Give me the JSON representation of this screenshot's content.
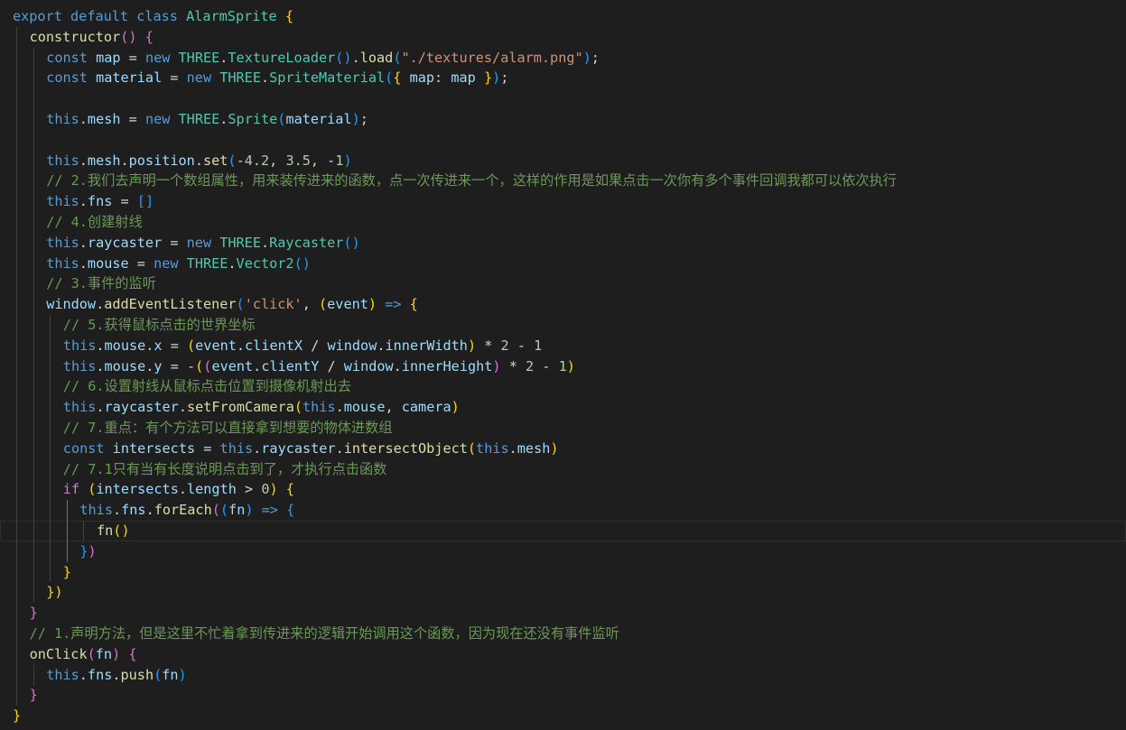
{
  "editor": {
    "language": "javascript",
    "theme": {
      "background": "#1e1e1e",
      "keyword": "#569cd6",
      "class": "#4ec9b0",
      "function": "#dcdcaa",
      "variable": "#9cdcfe",
      "string": "#ce9178",
      "number": "#b5cea8",
      "comment": "#6a9955",
      "control": "#c586c0"
    },
    "current_line": 25,
    "lines": [
      {
        "indent": 0,
        "tokens": [
          [
            "kw",
            "export"
          ],
          [
            "op",
            " "
          ],
          [
            "kw",
            "default"
          ],
          [
            "op",
            " "
          ],
          [
            "kw",
            "class"
          ],
          [
            "op",
            " "
          ],
          [
            "cls",
            "AlarmSprite"
          ],
          [
            "op",
            " "
          ],
          [
            "b1",
            "{"
          ]
        ]
      },
      {
        "indent": 1,
        "tokens": [
          [
            "fn",
            "constructor"
          ],
          [
            "b2",
            "()"
          ],
          [
            "op",
            " "
          ],
          [
            "b2",
            "{"
          ]
        ]
      },
      {
        "indent": 2,
        "tokens": [
          [
            "kw",
            "const"
          ],
          [
            "op",
            " "
          ],
          [
            "var",
            "map"
          ],
          [
            "op",
            " = "
          ],
          [
            "kw",
            "new"
          ],
          [
            "op",
            " "
          ],
          [
            "cls",
            "THREE"
          ],
          [
            "op",
            "."
          ],
          [
            "cls",
            "TextureLoader"
          ],
          [
            "b3",
            "()"
          ],
          [
            "op",
            "."
          ],
          [
            "fn",
            "load"
          ],
          [
            "b3",
            "("
          ],
          [
            "str",
            "\"./textures/alarm.png\""
          ],
          [
            "b3",
            ")"
          ],
          [
            "op",
            ";"
          ]
        ]
      },
      {
        "indent": 2,
        "tokens": [
          [
            "kw",
            "const"
          ],
          [
            "op",
            " "
          ],
          [
            "var",
            "material"
          ],
          [
            "op",
            " = "
          ],
          [
            "kw",
            "new"
          ],
          [
            "op",
            " "
          ],
          [
            "cls",
            "THREE"
          ],
          [
            "op",
            "."
          ],
          [
            "cls",
            "SpriteMaterial"
          ],
          [
            "b3",
            "("
          ],
          [
            "b1",
            "{"
          ],
          [
            "op",
            " "
          ],
          [
            "var",
            "map"
          ],
          [
            "op",
            ": "
          ],
          [
            "var",
            "map"
          ],
          [
            "op",
            " "
          ],
          [
            "b1",
            "}"
          ],
          [
            "b3",
            ")"
          ],
          [
            "op",
            ";"
          ]
        ]
      },
      {
        "indent": 0,
        "tokens": []
      },
      {
        "indent": 2,
        "tokens": [
          [
            "kw",
            "this"
          ],
          [
            "op",
            "."
          ],
          [
            "var",
            "mesh"
          ],
          [
            "op",
            " = "
          ],
          [
            "kw",
            "new"
          ],
          [
            "op",
            " "
          ],
          [
            "cls",
            "THREE"
          ],
          [
            "op",
            "."
          ],
          [
            "cls",
            "Sprite"
          ],
          [
            "b3",
            "("
          ],
          [
            "var",
            "material"
          ],
          [
            "b3",
            ")"
          ],
          [
            "op",
            ";"
          ]
        ]
      },
      {
        "indent": 0,
        "tokens": []
      },
      {
        "indent": 2,
        "tokens": [
          [
            "kw",
            "this"
          ],
          [
            "op",
            "."
          ],
          [
            "var",
            "mesh"
          ],
          [
            "op",
            "."
          ],
          [
            "var",
            "position"
          ],
          [
            "op",
            "."
          ],
          [
            "fn",
            "set"
          ],
          [
            "b3",
            "("
          ],
          [
            "op",
            "-"
          ],
          [
            "num",
            "4.2"
          ],
          [
            "op",
            ", "
          ],
          [
            "num",
            "3.5"
          ],
          [
            "op",
            ", -"
          ],
          [
            "num",
            "1"
          ],
          [
            "b3",
            ")"
          ]
        ]
      },
      {
        "indent": 2,
        "tokens": [
          [
            "cmt",
            "// 2.我们去声明一个数组属性，用来装传进来的函数，点一次传进来一个，这样的作用是如果点击一次你有多个事件回调我都可以依次执行"
          ]
        ]
      },
      {
        "indent": 2,
        "tokens": [
          [
            "kw",
            "this"
          ],
          [
            "op",
            "."
          ],
          [
            "var",
            "fns"
          ],
          [
            "op",
            " = "
          ],
          [
            "b3",
            "[]"
          ]
        ]
      },
      {
        "indent": 2,
        "tokens": [
          [
            "cmt",
            "// 4.创建射线"
          ]
        ]
      },
      {
        "indent": 2,
        "tokens": [
          [
            "kw",
            "this"
          ],
          [
            "op",
            "."
          ],
          [
            "var",
            "raycaster"
          ],
          [
            "op",
            " = "
          ],
          [
            "kw",
            "new"
          ],
          [
            "op",
            " "
          ],
          [
            "cls",
            "THREE"
          ],
          [
            "op",
            "."
          ],
          [
            "cls",
            "Raycaster"
          ],
          [
            "b3",
            "()"
          ]
        ]
      },
      {
        "indent": 2,
        "tokens": [
          [
            "kw",
            "this"
          ],
          [
            "op",
            "."
          ],
          [
            "var",
            "mouse"
          ],
          [
            "op",
            " = "
          ],
          [
            "kw",
            "new"
          ],
          [
            "op",
            " "
          ],
          [
            "cls",
            "THREE"
          ],
          [
            "op",
            "."
          ],
          [
            "cls",
            "Vector2"
          ],
          [
            "b3",
            "()"
          ]
        ]
      },
      {
        "indent": 2,
        "tokens": [
          [
            "cmt",
            "// 3.事件的监听"
          ]
        ]
      },
      {
        "indent": 2,
        "tokens": [
          [
            "var",
            "window"
          ],
          [
            "op",
            "."
          ],
          [
            "fn",
            "addEventListener"
          ],
          [
            "b3",
            "("
          ],
          [
            "str",
            "'click'"
          ],
          [
            "op",
            ", "
          ],
          [
            "b1",
            "("
          ],
          [
            "var",
            "event"
          ],
          [
            "b1",
            ")"
          ],
          [
            "op",
            " "
          ],
          [
            "kw",
            "=>"
          ],
          [
            "op",
            " "
          ],
          [
            "b1",
            "{"
          ]
        ]
      },
      {
        "indent": 3,
        "tokens": [
          [
            "cmt",
            "// 5.获得鼠标点击的世界坐标"
          ]
        ]
      },
      {
        "indent": 3,
        "tokens": [
          [
            "kw",
            "this"
          ],
          [
            "op",
            "."
          ],
          [
            "var",
            "mouse"
          ],
          [
            "op",
            "."
          ],
          [
            "var",
            "x"
          ],
          [
            "op",
            " = "
          ],
          [
            "b1",
            "("
          ],
          [
            "var",
            "event"
          ],
          [
            "op",
            "."
          ],
          [
            "var",
            "clientX"
          ],
          [
            "op",
            " / "
          ],
          [
            "var",
            "window"
          ],
          [
            "op",
            "."
          ],
          [
            "var",
            "innerWidth"
          ],
          [
            "b1",
            ")"
          ],
          [
            "op",
            " * "
          ],
          [
            "num",
            "2"
          ],
          [
            "op",
            " - "
          ],
          [
            "num",
            "1"
          ]
        ]
      },
      {
        "indent": 3,
        "tokens": [
          [
            "kw",
            "this"
          ],
          [
            "op",
            "."
          ],
          [
            "var",
            "mouse"
          ],
          [
            "op",
            "."
          ],
          [
            "var",
            "y"
          ],
          [
            "op",
            " = -"
          ],
          [
            "b1",
            "("
          ],
          [
            "b2",
            "("
          ],
          [
            "var",
            "event"
          ],
          [
            "op",
            "."
          ],
          [
            "var",
            "clientY"
          ],
          [
            "op",
            " / "
          ],
          [
            "var",
            "window"
          ],
          [
            "op",
            "."
          ],
          [
            "var",
            "innerHeight"
          ],
          [
            "b2",
            ")"
          ],
          [
            "op",
            " * "
          ],
          [
            "num",
            "2"
          ],
          [
            "op",
            " - "
          ],
          [
            "num",
            "1"
          ],
          [
            "b1",
            ")"
          ]
        ]
      },
      {
        "indent": 3,
        "tokens": [
          [
            "cmt",
            "// 6.设置射线从鼠标点击位置到摄像机射出去"
          ]
        ]
      },
      {
        "indent": 3,
        "tokens": [
          [
            "kw",
            "this"
          ],
          [
            "op",
            "."
          ],
          [
            "var",
            "raycaster"
          ],
          [
            "op",
            "."
          ],
          [
            "fn",
            "setFromCamera"
          ],
          [
            "b1",
            "("
          ],
          [
            "kw",
            "this"
          ],
          [
            "op",
            "."
          ],
          [
            "var",
            "mouse"
          ],
          [
            "op",
            ", "
          ],
          [
            "var",
            "camera"
          ],
          [
            "b1",
            ")"
          ]
        ]
      },
      {
        "indent": 3,
        "tokens": [
          [
            "cmt",
            "// 7.重点：有个方法可以直接拿到想要的物体进数组"
          ]
        ]
      },
      {
        "indent": 3,
        "tokens": [
          [
            "kw",
            "const"
          ],
          [
            "op",
            " "
          ],
          [
            "var",
            "intersects"
          ],
          [
            "op",
            " = "
          ],
          [
            "kw",
            "this"
          ],
          [
            "op",
            "."
          ],
          [
            "var",
            "raycaster"
          ],
          [
            "op",
            "."
          ],
          [
            "fn",
            "intersectObject"
          ],
          [
            "b1",
            "("
          ],
          [
            "kw",
            "this"
          ],
          [
            "op",
            "."
          ],
          [
            "var",
            "mesh"
          ],
          [
            "b1",
            ")"
          ]
        ]
      },
      {
        "indent": 3,
        "tokens": [
          [
            "cmt",
            "// 7.1只有当有长度说明点击到了，才执行点击函数"
          ]
        ]
      },
      {
        "indent": 3,
        "tokens": [
          [
            "ctl",
            "if"
          ],
          [
            "op",
            " "
          ],
          [
            "b1",
            "("
          ],
          [
            "var",
            "intersects"
          ],
          [
            "op",
            "."
          ],
          [
            "var",
            "length"
          ],
          [
            "op",
            " > "
          ],
          [
            "num",
            "0"
          ],
          [
            "b1",
            ")"
          ],
          [
            "op",
            " "
          ],
          [
            "b1",
            "{"
          ]
        ]
      },
      {
        "indent": 4,
        "tokens": [
          [
            "kw",
            "this"
          ],
          [
            "op",
            "."
          ],
          [
            "var",
            "fns"
          ],
          [
            "op",
            "."
          ],
          [
            "fn",
            "forEach"
          ],
          [
            "b2",
            "("
          ],
          [
            "b3",
            "("
          ],
          [
            "var",
            "fn"
          ],
          [
            "b3",
            ")"
          ],
          [
            "op",
            " "
          ],
          [
            "kw",
            "=>"
          ],
          [
            "op",
            " "
          ],
          [
            "b3",
            "{"
          ]
        ]
      },
      {
        "indent": 5,
        "tokens": [
          [
            "fn",
            "fn"
          ],
          [
            "b1",
            "()"
          ]
        ]
      },
      {
        "indent": 4,
        "tokens": [
          [
            "b3",
            "}"
          ],
          [
            "b2",
            ")"
          ]
        ]
      },
      {
        "indent": 3,
        "tokens": [
          [
            "b1",
            "}"
          ]
        ]
      },
      {
        "indent": 2,
        "tokens": [
          [
            "b1",
            "})"
          ]
        ]
      },
      {
        "indent": 1,
        "tokens": [
          [
            "b2",
            "}"
          ]
        ]
      },
      {
        "indent": 1,
        "tokens": [
          [
            "cmt",
            "// 1.声明方法，但是这里不忙着拿到传进来的逻辑开始调用这个函数，因为现在还没有事件监听"
          ]
        ]
      },
      {
        "indent": 1,
        "tokens": [
          [
            "fn",
            "onClick"
          ],
          [
            "b2",
            "("
          ],
          [
            "var",
            "fn"
          ],
          [
            "b2",
            ")"
          ],
          [
            "op",
            " "
          ],
          [
            "b2",
            "{"
          ]
        ]
      },
      {
        "indent": 2,
        "tokens": [
          [
            "kw",
            "this"
          ],
          [
            "op",
            "."
          ],
          [
            "var",
            "fns"
          ],
          [
            "op",
            "."
          ],
          [
            "fn",
            "push"
          ],
          [
            "b3",
            "("
          ],
          [
            "var",
            "fn"
          ],
          [
            "b3",
            ")"
          ]
        ]
      },
      {
        "indent": 1,
        "tokens": [
          [
            "b2",
            "}"
          ]
        ]
      },
      {
        "indent": 0,
        "tokens": [
          [
            "b1",
            "}"
          ]
        ]
      }
    ]
  }
}
